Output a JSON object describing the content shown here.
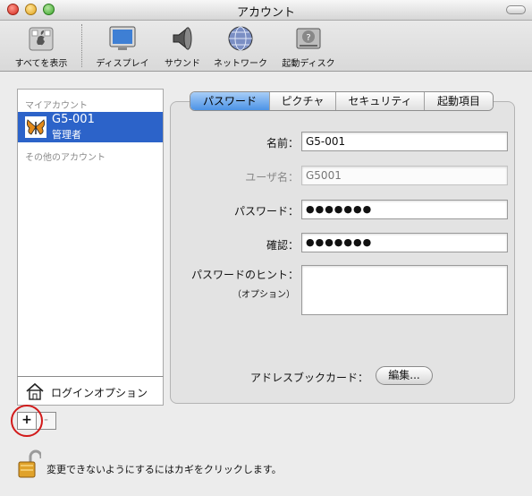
{
  "window": {
    "title": "アカウント"
  },
  "toolbar": {
    "items": [
      {
        "label": "すべてを表示",
        "icon": "apple-prefs-icon"
      },
      {
        "label": "ディスプレイ",
        "icon": "display-icon"
      },
      {
        "label": "サウンド",
        "icon": "speaker-icon"
      },
      {
        "label": "ネットワーク",
        "icon": "globe-icon"
      },
      {
        "label": "起動ディスク",
        "icon": "startup-disk-icon"
      }
    ]
  },
  "sidebar": {
    "my_account_header": "マイアカウント",
    "account": {
      "name": "G5-001",
      "role": "管理者",
      "icon": "butterfly-icon"
    },
    "other_accounts_header": "その他のアカウント",
    "login_options": "ログインオプション",
    "add_label": "+",
    "remove_label": "-"
  },
  "tabs": [
    {
      "label": "パスワード",
      "active": true
    },
    {
      "label": "ピクチャ",
      "active": false
    },
    {
      "label": "セキュリティ",
      "active": false
    },
    {
      "label": "起動項目",
      "active": false
    }
  ],
  "form": {
    "name_label": "名前：",
    "name_value": "G5-001",
    "username_label": "ユーザ名：",
    "username_value": "G5001",
    "password_label": "パスワード：",
    "password_value": "●●●●●●●",
    "verify_label": "確認：",
    "verify_value": "●●●●●●●",
    "hint_label": "パスワードのヒント：",
    "hint_optional": "（オプション）",
    "hint_value": "",
    "addressbook_label": "アドレスブックカード：",
    "edit_button": "編集..."
  },
  "footer": {
    "lock_text": "変更できないようにするにはカギをクリックします。"
  },
  "colors": {
    "selection": "#2c63c9",
    "annotation_circle": "#d21a1a",
    "active_tab": "#4c93e6"
  }
}
